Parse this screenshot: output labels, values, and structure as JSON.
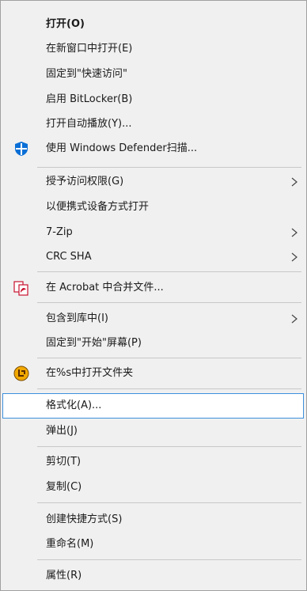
{
  "menu": {
    "items": [
      {
        "label": "打开(O)"
      },
      {
        "label": "在新窗口中打开(E)"
      },
      {
        "label": "固定到\"快速访问\""
      },
      {
        "label": "启用 BitLocker(B)"
      },
      {
        "label": "打开自动播放(Y)..."
      },
      {
        "label": "使用 Windows Defender扫描...",
        "icon": "windows-defender-shield-icon"
      },
      {
        "label": "授予访问权限(G)",
        "submenu": true
      },
      {
        "label": "以便携式设备方式打开"
      },
      {
        "label": "7-Zip",
        "submenu": true
      },
      {
        "label": "CRC SHA",
        "submenu": true
      },
      {
        "label": "在 Acrobat 中合并文件...",
        "icon": "acrobat-combine-files-icon"
      },
      {
        "label": "包含到库中(I)",
        "submenu": true
      },
      {
        "label": "固定到\"开始\"屏幕(P)"
      },
      {
        "label": "在%s中打开文件夹",
        "icon": "open-folder-app-icon"
      },
      {
        "label": "格式化(A)...",
        "highlighted": true
      },
      {
        "label": "弹出(J)"
      },
      {
        "label": "剪切(T)"
      },
      {
        "label": "复制(C)"
      },
      {
        "label": "创建快捷方式(S)"
      },
      {
        "label": "重命名(M)"
      },
      {
        "label": "属性(R)"
      }
    ]
  },
  "colors": {
    "menu_background": "#f0f0f0",
    "highlight_border": "#3c8fdc",
    "highlight_background": "#ffffff",
    "separator": "#c8c8c8",
    "defender_blue": "#0a6fd6",
    "acrobat_red": "#c8102e",
    "folder_app_orange": "#f2a900"
  }
}
